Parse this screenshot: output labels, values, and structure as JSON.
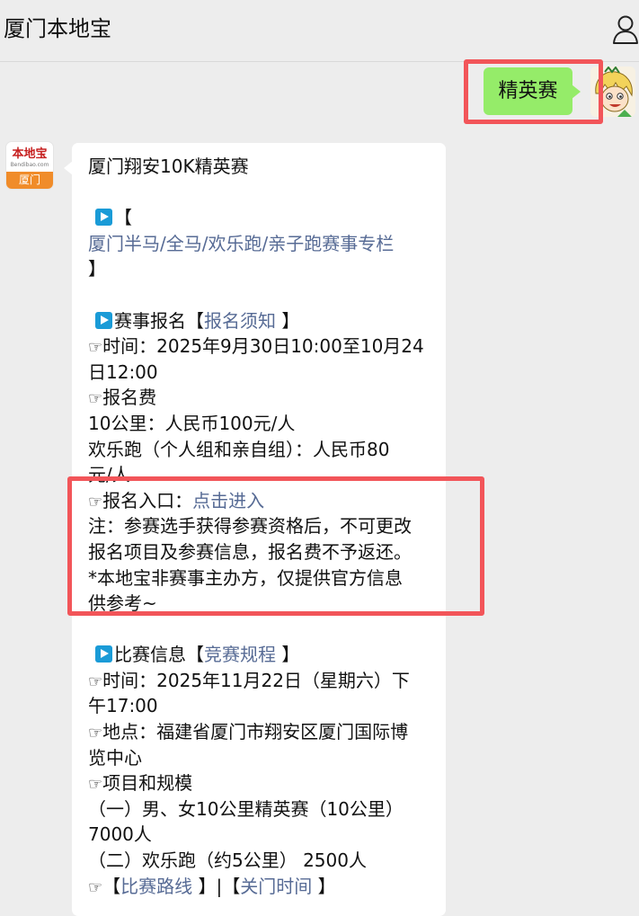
{
  "header": {
    "title": "厦门本地宝",
    "user_icon": "person-icon"
  },
  "my_message": {
    "text": "精英赛"
  },
  "bot": {
    "avatar": {
      "top": "本地宝",
      "url": "Bendibao.com",
      "bottom": "厦门"
    },
    "reply": {
      "title": "厦门翔安10K精英赛",
      "column_open": "【",
      "column_link": "厦门半马/全马/欢乐跑/亲子跑赛事专栏",
      "column_close": "】",
      "reg_heading": "赛事报名【",
      "reg_notice_link": "报名须知",
      "reg_close": " 】",
      "reg_time_1": "时间：2025年9月30日10:00至10月24",
      "reg_time_2": "日12:00",
      "fee_label": "报名费",
      "fee_10k": "10公里：人民币100元/人",
      "fee_fun_1": "欢乐跑（个人组和亲自组）：人民币80",
      "fee_fun_2": "元/人",
      "entry_label": "报名入口：",
      "entry_link": "点击进入",
      "note_1": "注：参赛选手获得参赛资格后，不可更改",
      "note_2": "报名项目及参赛信息，报名费不予返还。",
      "note_3": "*本地宝非赛事主办方，仅提供官方信息",
      "note_4": "供参考~",
      "race_heading": "比赛信息【",
      "race_rules_link": "竞赛规程",
      "race_close": " 】",
      "race_time_1": "时间：2025年11月22日（星期六）下",
      "race_time_2": "午17:00",
      "place_1": "地点：福建省厦门市翔安区厦门国际博",
      "place_2": "览中心",
      "items_label": "项目和规模",
      "item_1a": "（一）男、女10公里精英赛（10公里）",
      "item_1b": "7000人",
      "item_2": "（二）欢乐跑（约5公里） 2500人",
      "route_open": "【",
      "route_link": "比赛路线",
      "route_sep": " 】|【",
      "cutoff_link": "关门时间",
      "route_close": " 】"
    }
  },
  "icons": {
    "play": "play-icon",
    "pointing_hand": "pointing-hand-icon"
  },
  "colors": {
    "highlight": "#f25559",
    "my_bubble": "#95ec69",
    "link": "#576b95",
    "play_icon": "#1a9bd7"
  }
}
